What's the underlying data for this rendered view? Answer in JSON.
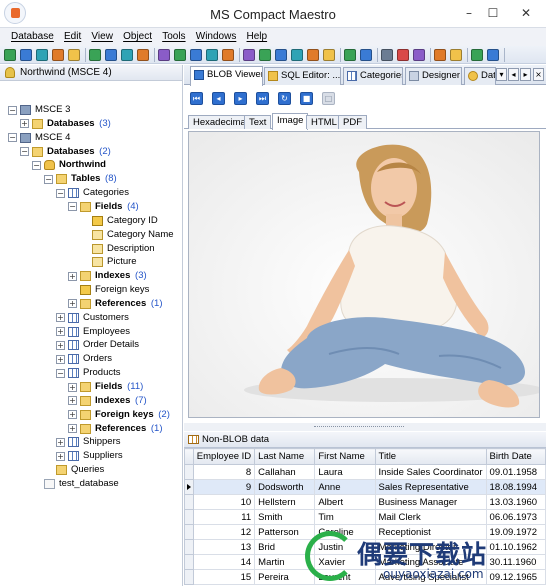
{
  "window": {
    "title": "MS Compact Maestro",
    "minimize": "–",
    "maximize": "☐",
    "close": "✕"
  },
  "menu": [
    "Database",
    "Edit",
    "View",
    "Object",
    "Tools",
    "Windows",
    "Help"
  ],
  "explorer": {
    "header": "Northwind (MSCE 4)",
    "tree": [
      {
        "label": "MSCE 3",
        "level": 0,
        "icon": "server-icon",
        "expander": "−"
      },
      {
        "label": "Databases",
        "count": "(3)",
        "level": 1,
        "icon": "folder-icon",
        "expander": "+",
        "bold": true
      },
      {
        "label": "MSCE 4",
        "level": 0,
        "icon": "server-icon",
        "expander": "−"
      },
      {
        "label": "Databases",
        "count": "(2)",
        "level": 1,
        "icon": "folder-icon",
        "expander": "−",
        "bold": true
      },
      {
        "label": "Northwind",
        "level": 2,
        "icon": "database-icon",
        "expander": "−",
        "bold": true,
        "selected": true
      },
      {
        "label": "Tables",
        "count": "(8)",
        "level": 3,
        "icon": "folder-icon",
        "expander": "−",
        "bold": true
      },
      {
        "label": "Categories",
        "level": 4,
        "icon": "table-icon",
        "expander": "−"
      },
      {
        "label": "Fields",
        "count": "(4)",
        "level": 5,
        "icon": "folder-icon",
        "expander": "−",
        "bold": true
      },
      {
        "label": "Category ID",
        "level": 6,
        "icon": "primary-key-icon"
      },
      {
        "label": "Category Name",
        "level": 6,
        "icon": "field-icon"
      },
      {
        "label": "Description",
        "level": 6,
        "icon": "field-icon"
      },
      {
        "label": "Picture",
        "level": 6,
        "icon": "field-icon"
      },
      {
        "label": "Indexes",
        "count": "(3)",
        "level": 5,
        "icon": "folder-icon",
        "expander": "+",
        "bold": true
      },
      {
        "label": "Foreign keys",
        "level": 5,
        "icon": "key-icon"
      },
      {
        "label": "References",
        "count": "(1)",
        "level": 5,
        "icon": "folder-icon",
        "expander": "+",
        "bold": true
      },
      {
        "label": "Customers",
        "level": 4,
        "icon": "table-icon",
        "expander": "+"
      },
      {
        "label": "Employees",
        "level": 4,
        "icon": "table-icon",
        "expander": "+"
      },
      {
        "label": "Order Details",
        "level": 4,
        "icon": "table-icon",
        "expander": "+"
      },
      {
        "label": "Orders",
        "level": 4,
        "icon": "table-icon",
        "expander": "+"
      },
      {
        "label": "Products",
        "level": 4,
        "icon": "table-icon",
        "expander": "−"
      },
      {
        "label": "Fields",
        "count": "(11)",
        "level": 5,
        "icon": "folder-icon",
        "expander": "+",
        "bold": true
      },
      {
        "label": "Indexes",
        "count": "(7)",
        "level": 5,
        "icon": "folder-icon",
        "expander": "+",
        "bold": true
      },
      {
        "label": "Foreign keys",
        "count": "(2)",
        "level": 5,
        "icon": "folder-icon",
        "expander": "+",
        "bold": true
      },
      {
        "label": "References",
        "count": "(1)",
        "level": 5,
        "icon": "folder-icon",
        "expander": "+",
        "bold": true
      },
      {
        "label": "Shippers",
        "level": 4,
        "icon": "table-icon",
        "expander": "+"
      },
      {
        "label": "Suppliers",
        "level": 4,
        "icon": "table-icon",
        "expander": "+"
      },
      {
        "label": "Queries",
        "level": 3,
        "icon": "folder-icon"
      },
      {
        "label": "test_database",
        "level": 2,
        "icon": "file-icon"
      }
    ]
  },
  "doc_tabs": [
    "BLOB Viewer",
    "SQL Editor: ...",
    "Categories",
    "Designer",
    "Dat"
  ],
  "nav_buttons": [
    "first",
    "previous",
    "next",
    "last",
    "refresh",
    "save",
    "clear"
  ],
  "view_tabs": [
    "Hexadecimal",
    "Text",
    "Image",
    "HTML",
    "PDF"
  ],
  "active_view_tab": "Image",
  "grid": {
    "title": "Non-BLOB data",
    "columns": [
      "Employee ID",
      "Last Name",
      "First Name",
      "Title",
      "Birth Date"
    ],
    "rows": [
      [
        "8",
        "Callahan",
        "Laura",
        "Inside Sales Coordinator",
        "09.01.1958"
      ],
      [
        "9",
        "Dodsworth",
        "Anne",
        "Sales Representative",
        "18.08.1994"
      ],
      [
        "10",
        "Hellstern",
        "Albert",
        "Business Manager",
        "13.03.1960"
      ],
      [
        "11",
        "Smith",
        "Tim",
        "Mail Clerk",
        "06.06.1973"
      ],
      [
        "12",
        "Patterson",
        "Caroline",
        "Receptionist",
        "19.09.1972"
      ],
      [
        "13",
        "Brid",
        "Justin",
        "Marketing Director",
        "01.10.1962"
      ],
      [
        "14",
        "Martin",
        "Xavier",
        "Marketing Associate",
        "30.11.1960"
      ],
      [
        "15",
        "Pereira",
        "Laurent",
        "Advertising Specialist",
        "09.12.1965"
      ]
    ],
    "current_row": 1
  },
  "watermark": {
    "text": "偶要下载站",
    "url": "ouyaoxiazai.com"
  },
  "colors": {
    "accent": "#2f6fcf",
    "selection": "#dfe9f8",
    "count": "#2455c8"
  }
}
